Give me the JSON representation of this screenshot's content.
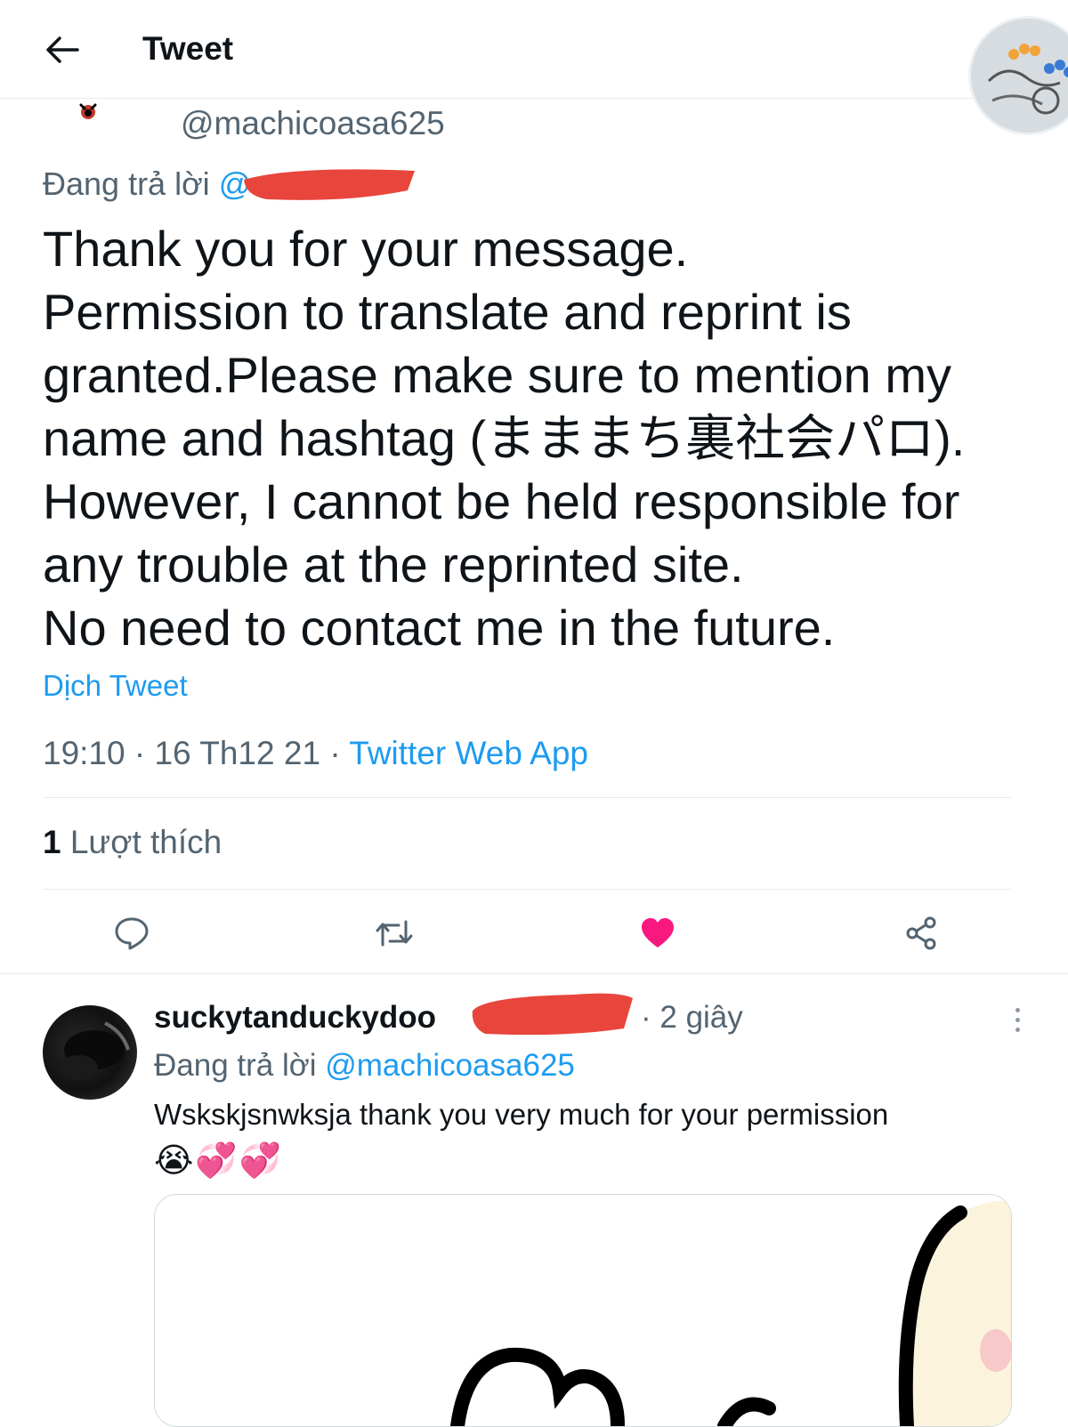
{
  "header": {
    "title": "Tweet"
  },
  "tweet": {
    "handle": "@machicoasa625",
    "reply_prefix": "Đang trả lời",
    "reply_handle_visible": "@",
    "lines": [
      "Thank you for your message.",
      "Permission to translate and reprint is",
      "granted.Please make sure to mention my",
      "name and hashtag (まままち裏社会パロ).",
      "However, I cannot be held responsible for",
      "any trouble at the reprinted site.",
      "No need to contact me in the future."
    ],
    "translate_label": "Dịch Tweet",
    "time": "19:10",
    "date": "16 Th12 21",
    "separator": "·",
    "source": "Twitter Web App",
    "like_count": "1",
    "like_label": "Lượt thích"
  },
  "actions": {
    "like_color": "#f91880",
    "liked": true
  },
  "reply": {
    "name": "suckytanduckydoo",
    "time": "· 2 giây",
    "reply_prefix": "Đang trả lời",
    "reply_mention": "@machicoasa625",
    "text": "Wskskjsnwksja thank you very much for your permission",
    "emojis": "😭💞💞"
  },
  "colors": {
    "accent": "#1d9bf0",
    "redaction": "#e8453c",
    "secondary_text": "#536471"
  }
}
